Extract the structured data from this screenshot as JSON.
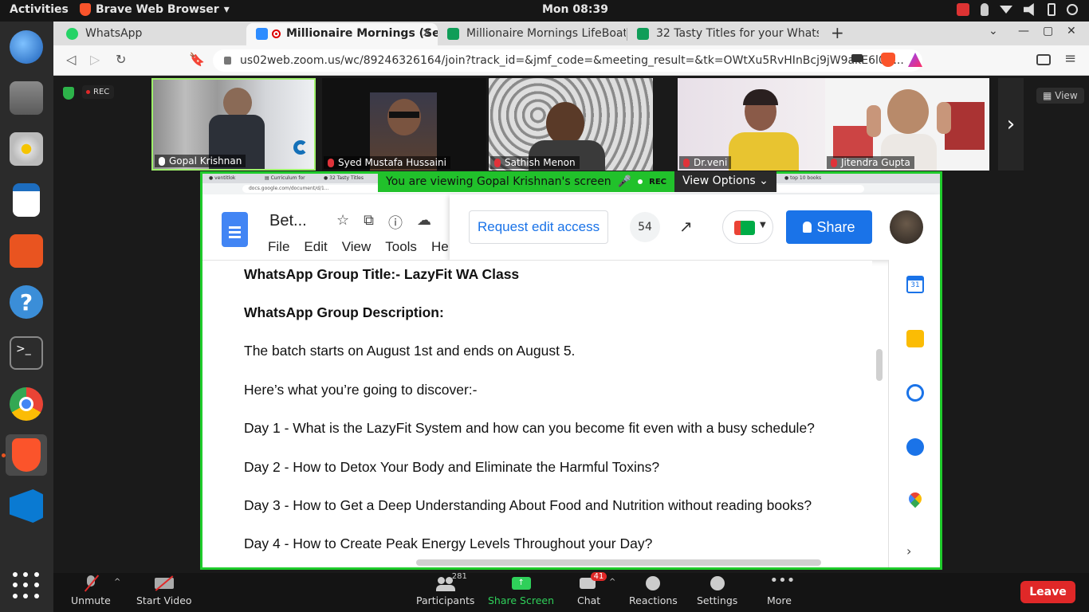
{
  "topbar": {
    "activities": "Activities",
    "app_name": "Brave Web Browser",
    "clock": "Mon 08:39"
  },
  "dock": {
    "items": [
      "thunderbird-icon",
      "files-icon",
      "rhythmbox-icon",
      "writer-icon",
      "software-icon",
      "help-icon",
      "terminal-icon",
      "chrome-icon",
      "brave-icon",
      "vscode-icon"
    ]
  },
  "browser": {
    "tabs": [
      {
        "label": "WhatsApp",
        "color": "#25d366"
      },
      {
        "label": "Millionaire Mornings (Se",
        "color": "#2d8cff"
      },
      {
        "label": "Millionaire Mornings LifeBoat",
        "color": "#0f9d58"
      },
      {
        "label": "32 Tasty Titles for your Whats",
        "color": "#0f9d58"
      }
    ],
    "url": "us02web.zoom.us/wc/89246326164/join?track_id=&jmf_code=&meeting_result=&tk=OWtXu5RvHInBcj9jW9akE6l0jF..."
  },
  "zoom": {
    "rec_label": "REC",
    "view_label": "View",
    "participants": [
      {
        "name": "Gopal Krishnan",
        "muted": false
      },
      {
        "name": "Syed Mustafa Hussaini",
        "muted": true
      },
      {
        "name": "Sathish Menon",
        "muted": true
      },
      {
        "name": "Dr.veni",
        "muted": true
      },
      {
        "name": "Jitendra Gupta",
        "muted": true
      }
    ],
    "share_banner": "You are viewing Gopal Krishnan's screen",
    "banner_rec": "REC",
    "view_options": "View Options",
    "toolbar": {
      "unmute": "Unmute",
      "start_video": "Start Video",
      "participants": "Participants",
      "participants_count": "281",
      "share_screen": "Share Screen",
      "chat": "Chat",
      "chat_badge": "41",
      "reactions": "Reactions",
      "settings": "Settings",
      "more": "More",
      "leave": "Leave"
    }
  },
  "doc": {
    "title": "Bet...",
    "menu": [
      "File",
      "Edit",
      "View",
      "Tools",
      "He"
    ],
    "request_edit": "Request edit access",
    "viewer_count": "54",
    "share_label": "Share",
    "lines": [
      {
        "text": "WhatsApp Group Title:- LazyFit WA Class",
        "bold": true
      },
      {
        "text": "WhatsApp Group Description:",
        "bold": true
      },
      {
        "text": "The batch starts on August 1st  and ends on August 5.",
        "bold": false
      },
      {
        "text": "Here’s what you’re going to discover:-",
        "bold": false
      },
      {
        "text": "Day 1 - What is the LazyFit System and how can you become fit even with a busy schedule?",
        "bold": false
      },
      {
        "text": "Day 2 - How to Detox Your Body and Eliminate the Harmful Toxins?",
        "bold": false
      },
      {
        "text": "Day 3 - How to Get a Deep Understanding About Food and Nutrition without reading books?",
        "bold": false
      },
      {
        "text": "Day 4 - How to Create  Peak Energy Levels Throughout your Day?",
        "bold": false
      }
    ]
  }
}
